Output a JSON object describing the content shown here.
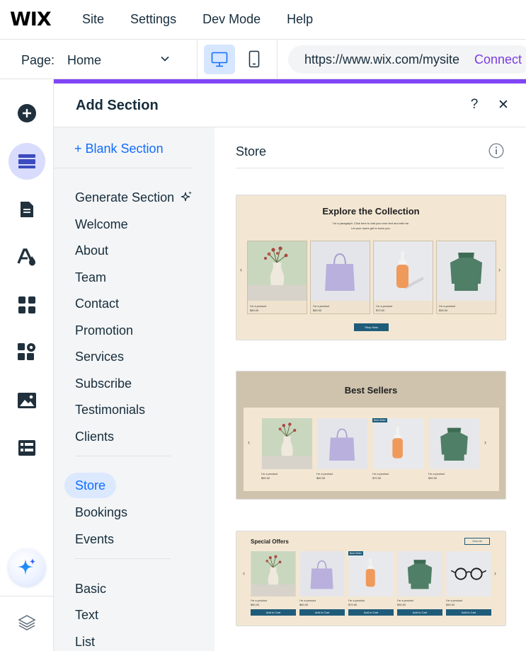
{
  "topbar": {
    "logo": "WIX",
    "menu": [
      "Site",
      "Settings",
      "Dev Mode",
      "Help"
    ]
  },
  "toolbar": {
    "page_label": "Page:",
    "page_value": "Home",
    "url": "https://www.wix.com/mysite",
    "connect": "Connect",
    "active_device": "desktop"
  },
  "rail": {
    "icons": [
      "add-icon",
      "sections-icon",
      "pages-icon",
      "design-icon",
      "apps-icon",
      "puzzle-icon",
      "media-icon",
      "cms-icon"
    ],
    "active": "sections-icon",
    "bottom_icons": [
      "ai-sparkle-icon",
      "layers-icon"
    ]
  },
  "panel": {
    "title": "Add Section",
    "help_label": "?",
    "close_label": "✕",
    "blank_section": "+  Blank Section",
    "categories_group1": [
      "Generate Section",
      "Welcome",
      "About",
      "Team",
      "Contact",
      "Promotion",
      "Services",
      "Subscribe",
      "Testimonials",
      "Clients"
    ],
    "categories_group2": [
      "Store",
      "Bookings",
      "Events"
    ],
    "categories_group3": [
      "Basic",
      "Text",
      "List"
    ],
    "selected_category": "Store",
    "preview_title": "Store"
  },
  "cards": [
    {
      "title": "Explore the Collection",
      "paragraph_line1": "I'm a paragraph. Click here to add your own text and edit me.",
      "paragraph_line2": "Let your users get to know you.",
      "product_name": "I'm a product",
      "prices": [
        "$50.00",
        "$60.00",
        "$70.00",
        "$30.00"
      ],
      "button": "Shop Now"
    },
    {
      "title": "Best Sellers",
      "badge": "Best Seller",
      "product_name": "I'm a product",
      "prices": [
        "$50.00",
        "$60.00",
        "$70.00",
        "$30.00"
      ]
    },
    {
      "title": "Special Offers",
      "view_all": "View All",
      "badge": "Best Seller",
      "product_name": "I'm a product",
      "prices": [
        "$50.00",
        "$60.00",
        "$70.00",
        "$30.00",
        "$30.00"
      ],
      "button": "Add to Cart"
    }
  ],
  "colors": {
    "accent": "#8046f5",
    "link": "#116dff",
    "selection_bg": "#dbe8fe",
    "card_bg": "#f3e7d3",
    "card2_bg": "#cfc3ad",
    "button": "#1f5c7a"
  }
}
